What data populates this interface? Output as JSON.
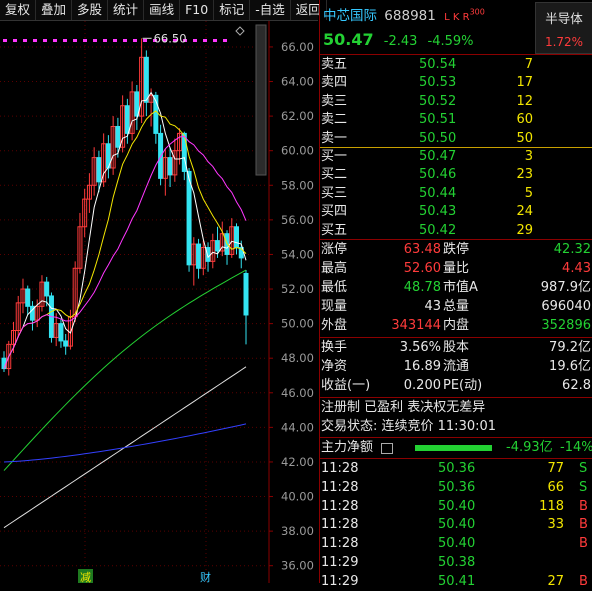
{
  "toolbar": [
    "复权",
    "叠加",
    "多股",
    "统计",
    "画线",
    "F10",
    "标记",
    "-自选",
    "返回"
  ],
  "chart": {
    "y_ticks": [
      "66.00",
      "64.00",
      "62.00",
      "60.00",
      "58.00",
      "56.00",
      "54.00",
      "52.00",
      "50.00",
      "48.00",
      "46.00",
      "44.00",
      "42.00",
      "40.00",
      "38.00",
      "36.00"
    ],
    "high_label": "66.50",
    "bottom_marks": [
      "减",
      "财"
    ],
    "colors": {
      "up": "#ff3b3b",
      "down": "#33e4f2",
      "ma5": "#ffffff",
      "ma10": "#f3e600",
      "ma20": "#ff37ff",
      "ma60": "#23d133",
      "ma120": "#e0e0e0",
      "ma250": "#3340ff"
    }
  },
  "chart_data": {
    "type": "candlestick",
    "ylim": [
      35,
      67.5
    ],
    "y_ticks": [
      66,
      64,
      62,
      60,
      58,
      56,
      54,
      52,
      50,
      48,
      46,
      44,
      42,
      40,
      38,
      36
    ],
    "candles": [
      [
        48.0,
        47.4,
        48.4,
        47.2
      ],
      [
        47.4,
        48.8,
        49.0,
        47.0
      ],
      [
        48.8,
        49.6,
        50.1,
        48.3
      ],
      [
        49.6,
        51.2,
        51.6,
        49.2
      ],
      [
        51.2,
        52.0,
        52.6,
        50.6
      ],
      [
        52.0,
        51.0,
        52.2,
        50.5
      ],
      [
        51.0,
        50.2,
        51.3,
        49.6
      ],
      [
        50.2,
        51.0,
        51.4,
        49.8
      ],
      [
        51.0,
        52.4,
        52.8,
        50.7
      ],
      [
        52.4,
        51.6,
        52.7,
        51.0
      ],
      [
        51.6,
        49.2,
        51.8,
        48.9
      ],
      [
        49.2,
        50.0,
        50.6,
        48.7
      ],
      [
        50.0,
        49.0,
        50.3,
        48.6
      ],
      [
        49.0,
        48.7,
        49.4,
        48.2
      ],
      [
        48.7,
        50.4,
        50.8,
        48.5
      ],
      [
        50.4,
        53.2,
        53.6,
        50.1
      ],
      [
        53.2,
        55.6,
        56.4,
        52.9
      ],
      [
        55.6,
        57.2,
        57.8,
        55.0
      ],
      [
        57.2,
        58.0,
        58.7,
        56.4
      ],
      [
        58.0,
        59.6,
        60.2,
        57.4
      ],
      [
        59.6,
        58.2,
        60.0,
        57.6
      ],
      [
        58.2,
        60.4,
        61.0,
        57.9
      ],
      [
        60.4,
        59.0,
        60.9,
        58.4
      ],
      [
        59.0,
        61.4,
        62.0,
        58.6
      ],
      [
        61.4,
        60.2,
        61.9,
        59.6
      ],
      [
        60.2,
        62.6,
        63.2,
        59.9
      ],
      [
        62.6,
        61.0,
        63.0,
        60.4
      ],
      [
        61.0,
        63.4,
        64.0,
        60.6
      ],
      [
        63.4,
        62.0,
        63.8,
        61.2
      ],
      [
        62.0,
        65.4,
        66.5,
        61.6
      ],
      [
        65.4,
        62.8,
        65.8,
        62.0
      ],
      [
        62.8,
        63.2,
        63.6,
        61.4
      ],
      [
        63.2,
        61.0,
        63.4,
        60.4
      ],
      [
        61.0,
        58.4,
        61.5,
        58.0
      ],
      [
        58.4,
        59.6,
        60.1,
        57.4
      ],
      [
        59.6,
        58.6,
        60.2,
        57.9
      ],
      [
        58.6,
        60.0,
        60.7,
        58.2
      ],
      [
        60.0,
        61.0,
        61.3,
        59.2
      ],
      [
        61.0,
        58.8,
        61.1,
        58.3
      ],
      [
        58.8,
        53.4,
        59.0,
        53.0
      ],
      [
        53.4,
        54.6,
        55.0,
        52.2
      ],
      [
        54.6,
        53.2,
        54.9,
        52.6
      ],
      [
        53.2,
        54.4,
        54.8,
        52.8
      ],
      [
        54.4,
        53.6,
        54.7,
        53.0
      ],
      [
        53.6,
        54.8,
        55.2,
        53.2
      ],
      [
        54.8,
        54.2,
        55.6,
        53.8
      ],
      [
        54.2,
        55.2,
        55.9,
        53.9
      ],
      [
        55.2,
        54.0,
        55.4,
        53.4
      ],
      [
        54.0,
        55.6,
        56.1,
        53.8
      ],
      [
        55.6,
        54.4,
        55.8,
        54.0
      ],
      [
        54.4,
        53.8,
        54.8,
        53.2
      ],
      [
        52.9,
        50.5,
        53.1,
        48.8
      ]
    ],
    "current_price": 50.47
  },
  "stock": {
    "name": "中芯国际",
    "code": "688981",
    "tags": "L K R",
    "tag_sup": "300",
    "sector": "半导体",
    "sector_pct": "1.72%",
    "price": "50.47",
    "change": "-2.43",
    "pct": "-4.59%"
  },
  "asks": [
    {
      "label": "卖五",
      "price": "50.54",
      "vol": "7"
    },
    {
      "label": "卖四",
      "price": "50.53",
      "vol": "17"
    },
    {
      "label": "卖三",
      "price": "50.52",
      "vol": "12"
    },
    {
      "label": "卖二",
      "price": "50.51",
      "vol": "60"
    },
    {
      "label": "卖一",
      "price": "50.50",
      "vol": "50"
    }
  ],
  "bids": [
    {
      "label": "买一",
      "price": "50.47",
      "vol": "3"
    },
    {
      "label": "买二",
      "price": "50.46",
      "vol": "23"
    },
    {
      "label": "买三",
      "price": "50.44",
      "vol": "5"
    },
    {
      "label": "买四",
      "price": "50.43",
      "vol": "24"
    },
    {
      "label": "买五",
      "price": "50.42",
      "vol": "29"
    }
  ],
  "stats1": [
    {
      "l1": "涨停",
      "v1": "63.48",
      "c1": "red",
      "l2": "跌停",
      "v2": "42.32",
      "c2": "green"
    },
    {
      "l1": "最高",
      "v1": "52.60",
      "c1": "red",
      "l2": "量比",
      "v2": "4.43",
      "c2": "red"
    },
    {
      "l1": "最低",
      "v1": "48.78",
      "c1": "green",
      "l2": "市值A",
      "v2": "987.9亿",
      "c2": "white"
    },
    {
      "l1": "现量",
      "v1": "43",
      "c1": "white",
      "l2": "总量",
      "v2": "696040",
      "c2": "white"
    },
    {
      "l1": "外盘",
      "v1": "343144",
      "c1": "red",
      "l2": "内盘",
      "v2": "352896",
      "c2": "green"
    }
  ],
  "stats2": [
    {
      "l1": "换手",
      "v1": "3.56%",
      "l2": "股本",
      "v2": "79.2亿"
    },
    {
      "l1": "净资",
      "v1": "16.89",
      "l2": "流通",
      "v2": "19.6亿"
    },
    {
      "l1": "收益(一)",
      "v1": "0.200",
      "l2": "PE(动)",
      "v2": "62.8"
    }
  ],
  "info": {
    "line1": "注册制 已盈利 表决权无差异",
    "line2": "交易状态: 连续竞价 11:30:01"
  },
  "flow": {
    "label": "主力净额",
    "value": "-4.93亿",
    "pct": "-14%",
    "bar_ratio": 0.45
  },
  "ticks": [
    {
      "time": "11:28",
      "price": "50.36",
      "vol": "77",
      "bs": "S"
    },
    {
      "time": "11:28",
      "price": "50.36",
      "vol": "66",
      "bs": "S"
    },
    {
      "time": "11:28",
      "price": "50.40",
      "vol": "118",
      "bs": "B"
    },
    {
      "time": "11:28",
      "price": "50.40",
      "vol": "33",
      "bs": "B"
    },
    {
      "time": "11:28",
      "price": "50.40",
      "vol": "",
      "bs": "B"
    },
    {
      "time": "11:29",
      "price": "50.38",
      "vol": "",
      "bs": ""
    },
    {
      "time": "11:29",
      "price": "50.41",
      "vol": "27",
      "bs": "B"
    }
  ]
}
